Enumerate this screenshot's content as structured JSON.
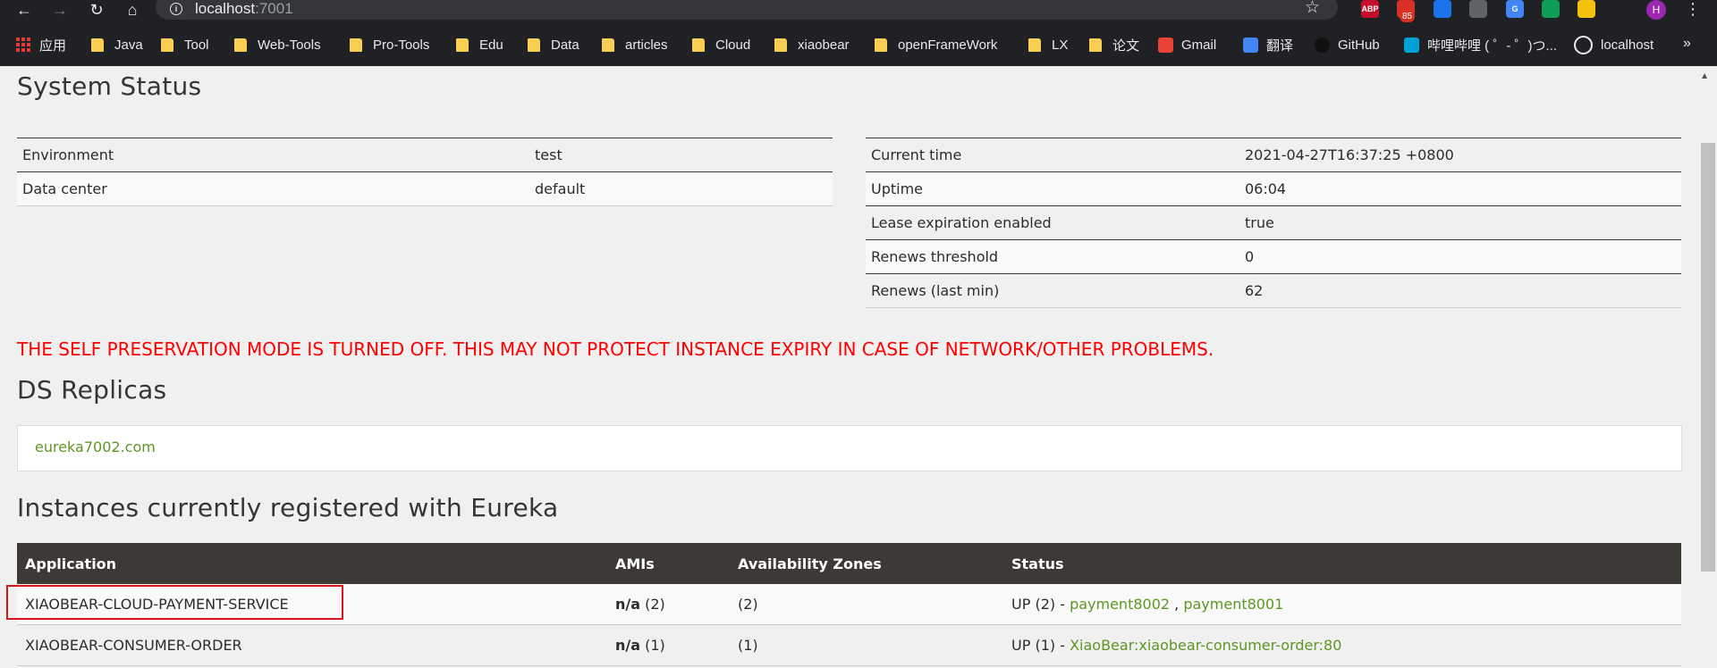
{
  "browser": {
    "url_host": "localhost",
    "url_port": ":7001",
    "extensions": [
      {
        "name": "abp-icon",
        "label": "ABP",
        "color": "#c70d2c"
      },
      {
        "name": "extension-red-icon",
        "label": "",
        "color": "#d93025",
        "badge": "85"
      },
      {
        "name": "extension-shield-icon",
        "label": "",
        "color": "#1a73e8"
      },
      {
        "name": "extension-mask-icon",
        "label": "",
        "color": "#5f6368"
      },
      {
        "name": "google-translate-icon",
        "label": "G",
        "color": "#4285f4"
      },
      {
        "name": "extension-edge-icon",
        "label": "",
        "color": "#0f9d58"
      },
      {
        "name": "extension-pikachu-icon",
        "label": "",
        "color": "#f4c20d"
      },
      {
        "name": "extensions-puzzle-icon",
        "label": "",
        "color": "#202124"
      }
    ],
    "profile_initial": "H",
    "bookmarks": [
      {
        "label": "应用",
        "type": "apps"
      },
      {
        "label": "Java",
        "type": "folder"
      },
      {
        "label": "Tool",
        "type": "folder"
      },
      {
        "label": "Web-Tools",
        "type": "folder"
      },
      {
        "label": "Pro-Tools",
        "type": "folder"
      },
      {
        "label": "Edu",
        "type": "folder"
      },
      {
        "label": "Data",
        "type": "folder"
      },
      {
        "label": "articles",
        "type": "folder"
      },
      {
        "label": "Cloud",
        "type": "folder"
      },
      {
        "label": "xiaobear",
        "type": "folder"
      },
      {
        "label": "openFrameWork",
        "type": "folder"
      },
      {
        "label": "LX",
        "type": "folder"
      },
      {
        "label": "论文",
        "type": "folder"
      },
      {
        "label": "Gmail",
        "type": "gmail"
      },
      {
        "label": "翻译",
        "type": "translate"
      },
      {
        "label": "GitHub",
        "type": "github"
      },
      {
        "label": "哔哩哔哩 ( ゜- ゜)つ...",
        "type": "bilibili"
      },
      {
        "label": "localhost",
        "type": "globe"
      }
    ],
    "overflow_label": "»"
  },
  "system_status": {
    "title": "System Status",
    "left": [
      {
        "key": "Environment",
        "value": "test"
      },
      {
        "key": "Data center",
        "value": "default"
      }
    ],
    "right": [
      {
        "key": "Current time",
        "value": "2021-04-27T16:37:25 +0800"
      },
      {
        "key": "Uptime",
        "value": "06:04"
      },
      {
        "key": "Lease expiration enabled",
        "value": "true"
      },
      {
        "key": "Renews threshold",
        "value": "0"
      },
      {
        "key": "Renews (last min)",
        "value": "62"
      }
    ]
  },
  "warning": "THE SELF PRESERVATION MODE IS TURNED OFF. THIS MAY NOT PROTECT INSTANCE EXPIRY IN CASE OF NETWORK/OTHER PROBLEMS.",
  "replicas": {
    "title": "DS Replicas",
    "items": [
      "eureka7002.com"
    ]
  },
  "instances": {
    "title": "Instances currently registered with Eureka",
    "columns": [
      "Application",
      "AMIs",
      "Availability Zones",
      "Status"
    ],
    "rows": [
      {
        "application": "XIAOBEAR-CLOUD-PAYMENT-SERVICE",
        "amis_bold": "n/a",
        "amis_count": " (2)",
        "zones": "(2)",
        "status_prefix": "UP (2) - ",
        "links": [
          "payment8002",
          "payment8001"
        ]
      },
      {
        "application": "XIAOBEAR-CONSUMER-ORDER",
        "amis_bold": "n/a",
        "amis_count": " (1)",
        "zones": "(1)",
        "status_prefix": "UP (1) - ",
        "links": [
          "XiaoBear:xiaobear-consumer-order:80"
        ]
      }
    ]
  }
}
